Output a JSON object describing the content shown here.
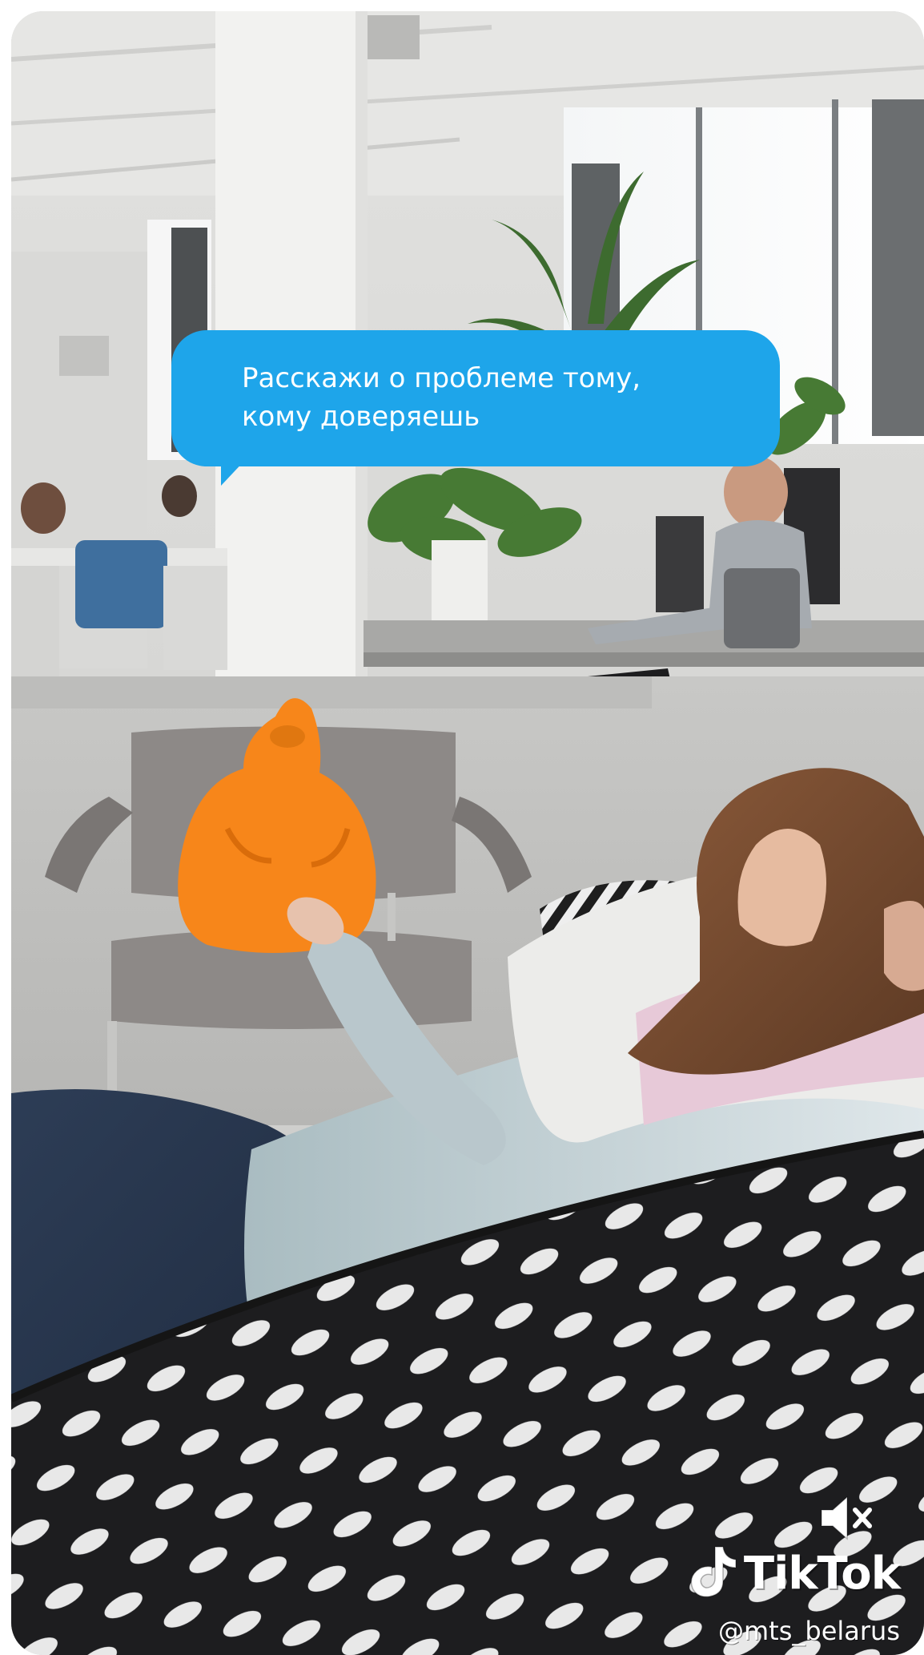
{
  "video": {
    "caption_lines": [
      "Расскажи о проблеме тому,",
      "кому доверяешь"
    ],
    "mute_icon": "muted-speaker-icon",
    "brand_icon": "tiktok-note-icon",
    "brand_name": "TikTok",
    "username": "@mts_belarus",
    "colors": {
      "caption_bubble": "#1ea5ea",
      "toy_orange": "#f7861a"
    }
  }
}
